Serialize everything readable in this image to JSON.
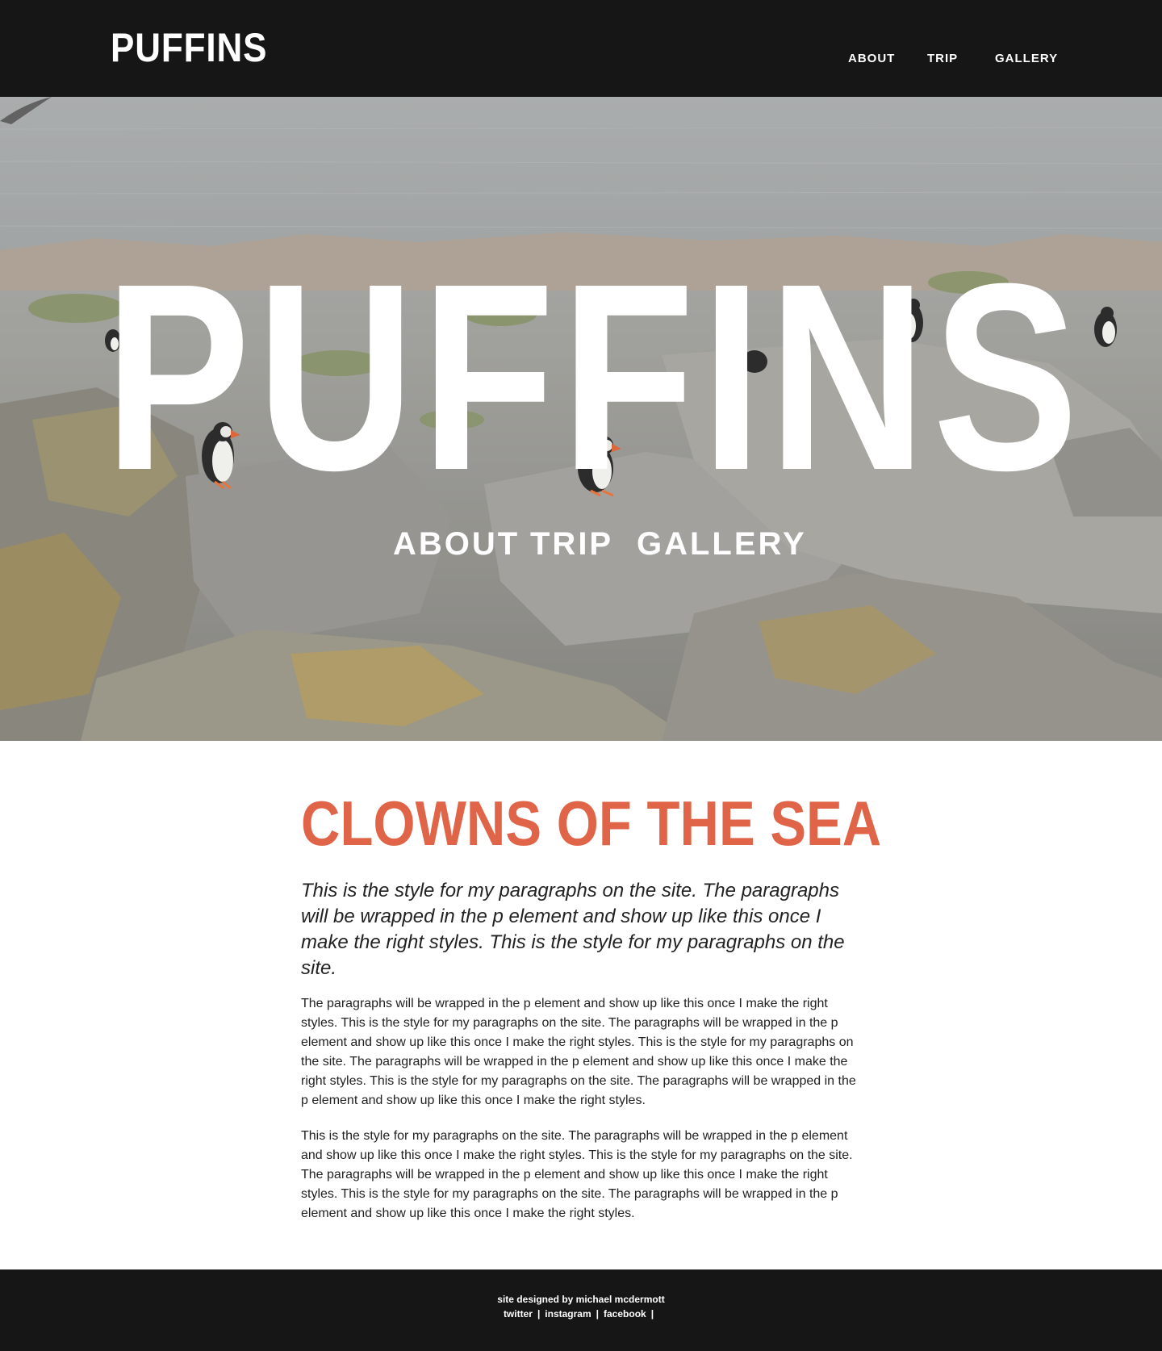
{
  "header": {
    "logo": "PUFFINS",
    "nav": [
      "ABOUT",
      "TRIP",
      "GALLERY"
    ]
  },
  "hero": {
    "title": "PUFFINS",
    "nav": [
      "ABOUT",
      "TRIP",
      "GALLERY"
    ]
  },
  "main": {
    "headline": "CLOWNS OF THE SEA",
    "lead": "This is the style for my paragraphs on the site. The paragraphs will be wrapped in the p element and show up like this once I make the right styles. This is the style for my paragraphs on the site.",
    "paragraphs": [
      "The paragraphs will be wrapped in the p element and show up like this once I make the right styles. This is the style for my paragraphs on the site. The paragraphs will be wrapped in the p element and show up like this once I make the right styles. This is the style for my paragraphs on the site. The paragraphs will be wrapped in the p element and show up like this once I make the right styles. This is the style for my paragraphs on the site. The paragraphs will be wrapped in the p element and show up like this once I make the right styles.",
      "This is the style for my paragraphs on the site. The paragraphs will be wrapped in the p element and show up like this once I make the right styles. This is the style for my paragraphs on the site. The paragraphs will be wrapped in the p element and show up like this once I make the right styles. This is the style for my paragraphs on the site. The paragraphs will be wrapped in the p element and show up like this once I make the right styles."
    ]
  },
  "footer": {
    "credit": "site designed by michael mcdermott",
    "links": [
      "twitter",
      "instagram",
      "facebook"
    ],
    "separator": "|"
  },
  "colors": {
    "bar": "#161616",
    "accent": "#e06448",
    "text": "#222222"
  }
}
